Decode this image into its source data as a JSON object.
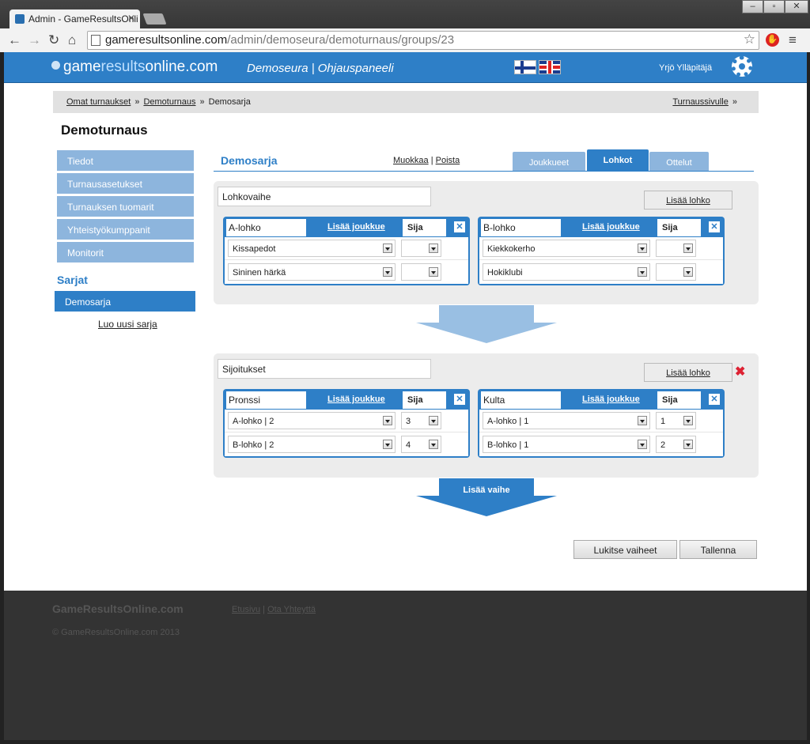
{
  "browser": {
    "tab_title": "Admin - GameResultsOnli",
    "url_host": "gameresultsonline.com",
    "url_path": "/admin/demoseura/demoturnaus/groups/23"
  },
  "header": {
    "logo_pre": "game",
    "logo_mid": "results",
    "logo_post": "online.com",
    "club_title": "Demoseura | Ohjauspaneeli",
    "user_name": "Yrjö Ylläpitäjä",
    "brand_color": "#2e7fc7"
  },
  "breadcrumb": {
    "item1": "Omat turnaukset",
    "item2": "Demoturnaus",
    "current": "Demosarja",
    "right_link": "Turnaussivulle"
  },
  "page_title": "Demoturnaus",
  "sidebar": {
    "items": [
      {
        "label": "Tiedot"
      },
      {
        "label": "Turnausasetukset"
      },
      {
        "label": "Turnauksen tuomarit"
      },
      {
        "label": "Yhteistyökumppanit"
      },
      {
        "label": "Monitorit"
      }
    ],
    "section_title": "Sarjat",
    "active_serie": "Demosarja",
    "new_serie_link": "Luo uusi sarja"
  },
  "serie": {
    "title": "Demosarja",
    "edit_link": "Muokkaa",
    "sep": "|",
    "delete_link": "Poista",
    "tabs": [
      {
        "label": "Joukkueet"
      },
      {
        "label": "Lohkot"
      },
      {
        "label": "Ottelut"
      }
    ]
  },
  "stages": [
    {
      "name": "Lohkovaihe",
      "add_group": "Lisää lohko",
      "groups": [
        {
          "name": "A-lohko",
          "add_team": "Lisää joukkue",
          "rank_header": "Sija",
          "rows": [
            {
              "team": "Kissapedot",
              "rank": ""
            },
            {
              "team": "Sininen härkä",
              "rank": ""
            }
          ]
        },
        {
          "name": "B-lohko",
          "add_team": "Lisää joukkue",
          "rank_header": "Sija",
          "rows": [
            {
              "team": "Kiekkokerho",
              "rank": ""
            },
            {
              "team": "Hokiklubi",
              "rank": ""
            }
          ]
        }
      ]
    },
    {
      "name": "Sijoitukset",
      "add_group": "Lisää lohko",
      "groups": [
        {
          "name": "Pronssi",
          "add_team": "Lisää joukkue",
          "rank_header": "Sija",
          "rows": [
            {
              "team": "A-lohko | 2",
              "rank": "3"
            },
            {
              "team": "B-lohko | 2",
              "rank": "4"
            }
          ]
        },
        {
          "name": "Kulta",
          "add_team": "Lisää joukkue",
          "rank_header": "Sija",
          "rows": [
            {
              "team": "A-lohko | 1",
              "rank": "1"
            },
            {
              "team": "B-lohko | 1",
              "rank": "2"
            }
          ]
        }
      ]
    }
  ],
  "add_stage_label": "Lisää vaihe",
  "buttons": {
    "lock": "Lukitse vaiheet",
    "save": "Tallenna"
  },
  "footer": {
    "brand": "GameResultsOnline.com",
    "link1": "Etusivu",
    "sep": "|",
    "link2": "Ota Yhteyttä",
    "copyright": "© GameResultsOnline.com 2013"
  }
}
